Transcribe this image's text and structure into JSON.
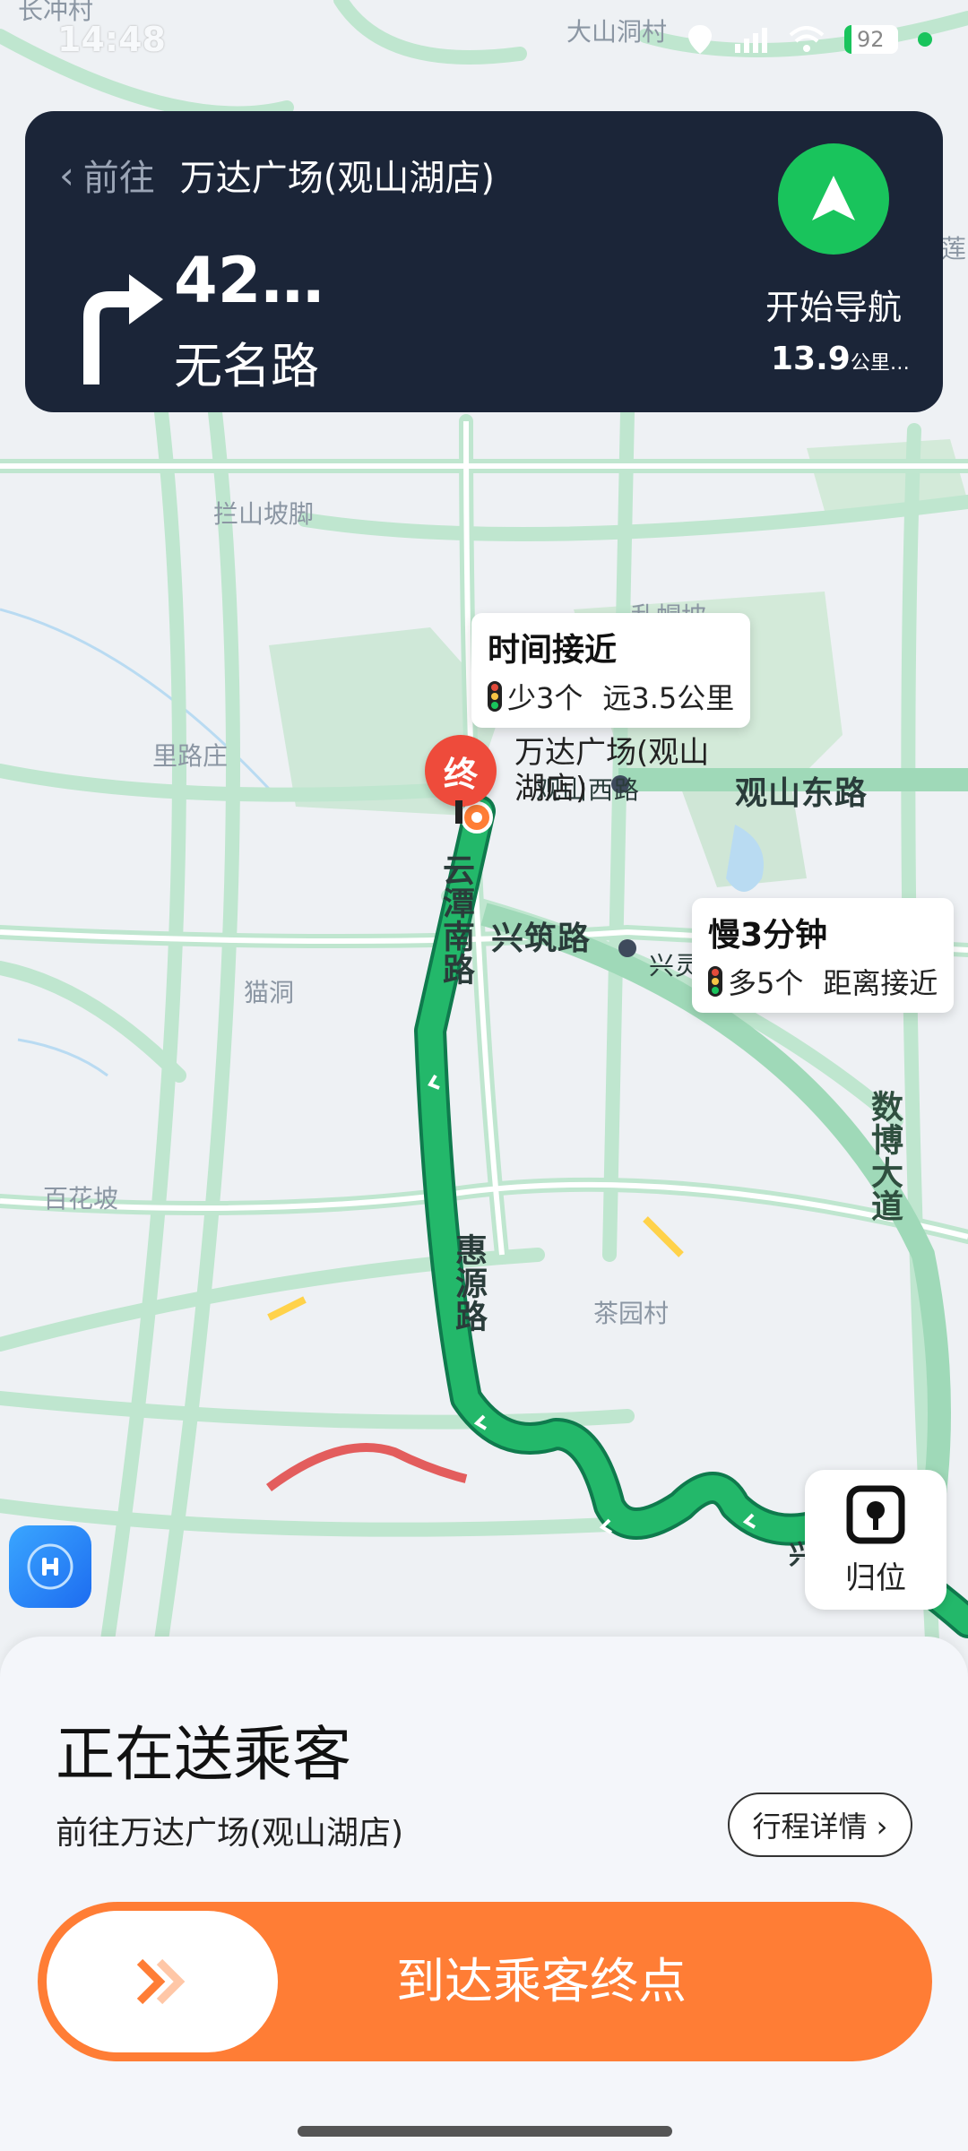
{
  "status_bar": {
    "time": "14:48",
    "battery": "92"
  },
  "nav_card": {
    "prefix": "前往",
    "destination": "万达广场(观山湖店)",
    "next_distance": "42…",
    "next_road": "无名路",
    "start_label": "开始导航",
    "total_distance": "13.9",
    "total_unit": "公里…",
    "accent": "#19c45c"
  },
  "map": {
    "places": [
      "大山洞村",
      "拦山坡脚",
      "里路庄",
      "猫洞",
      "百花坡",
      "茶园村",
      "莲",
      "长冲村",
      "乱帽坡"
    ],
    "roads": [
      "观山东路",
      "兴筑路",
      "云潭南路",
      "惠源路",
      "数博大道",
      "观山西路",
      "兴灵路",
      "兴筑"
    ],
    "destination_label": "万达广场(观山湖店)",
    "end_pin_label": "终"
  },
  "route_callouts": [
    {
      "title": "时间接近",
      "lights": "少3个",
      "detail": "远3.5公里"
    },
    {
      "title": "慢3分钟",
      "lights": "多5个",
      "detail": "距离接近"
    }
  ],
  "locate": {
    "label": "归位"
  },
  "sheet": {
    "title": "正在送乘客",
    "subtitle": "前往万达广场(观山湖店)",
    "detail_button": "行程详情 ›",
    "slider_label": "到达乘客终点",
    "accent": "#ff7d35"
  }
}
